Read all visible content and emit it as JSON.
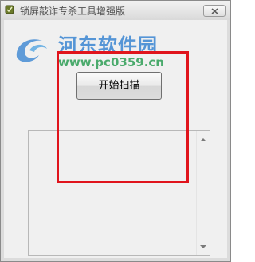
{
  "window": {
    "title": "锁屏敲诈专杀工具增强版",
    "close_icon": "close-icon",
    "app_icon": "shield-icon"
  },
  "watermark": {
    "title": "河东软件园",
    "url": "www.pc0359.cn",
    "logo_icon": "swirl-logo-icon"
  },
  "main": {
    "scan_button_label": "开始扫描",
    "output_text": ""
  },
  "colors": {
    "highlight": "#e0141c",
    "watermark_blue": "#2f7fd0",
    "watermark_green": "#2e9e55"
  }
}
